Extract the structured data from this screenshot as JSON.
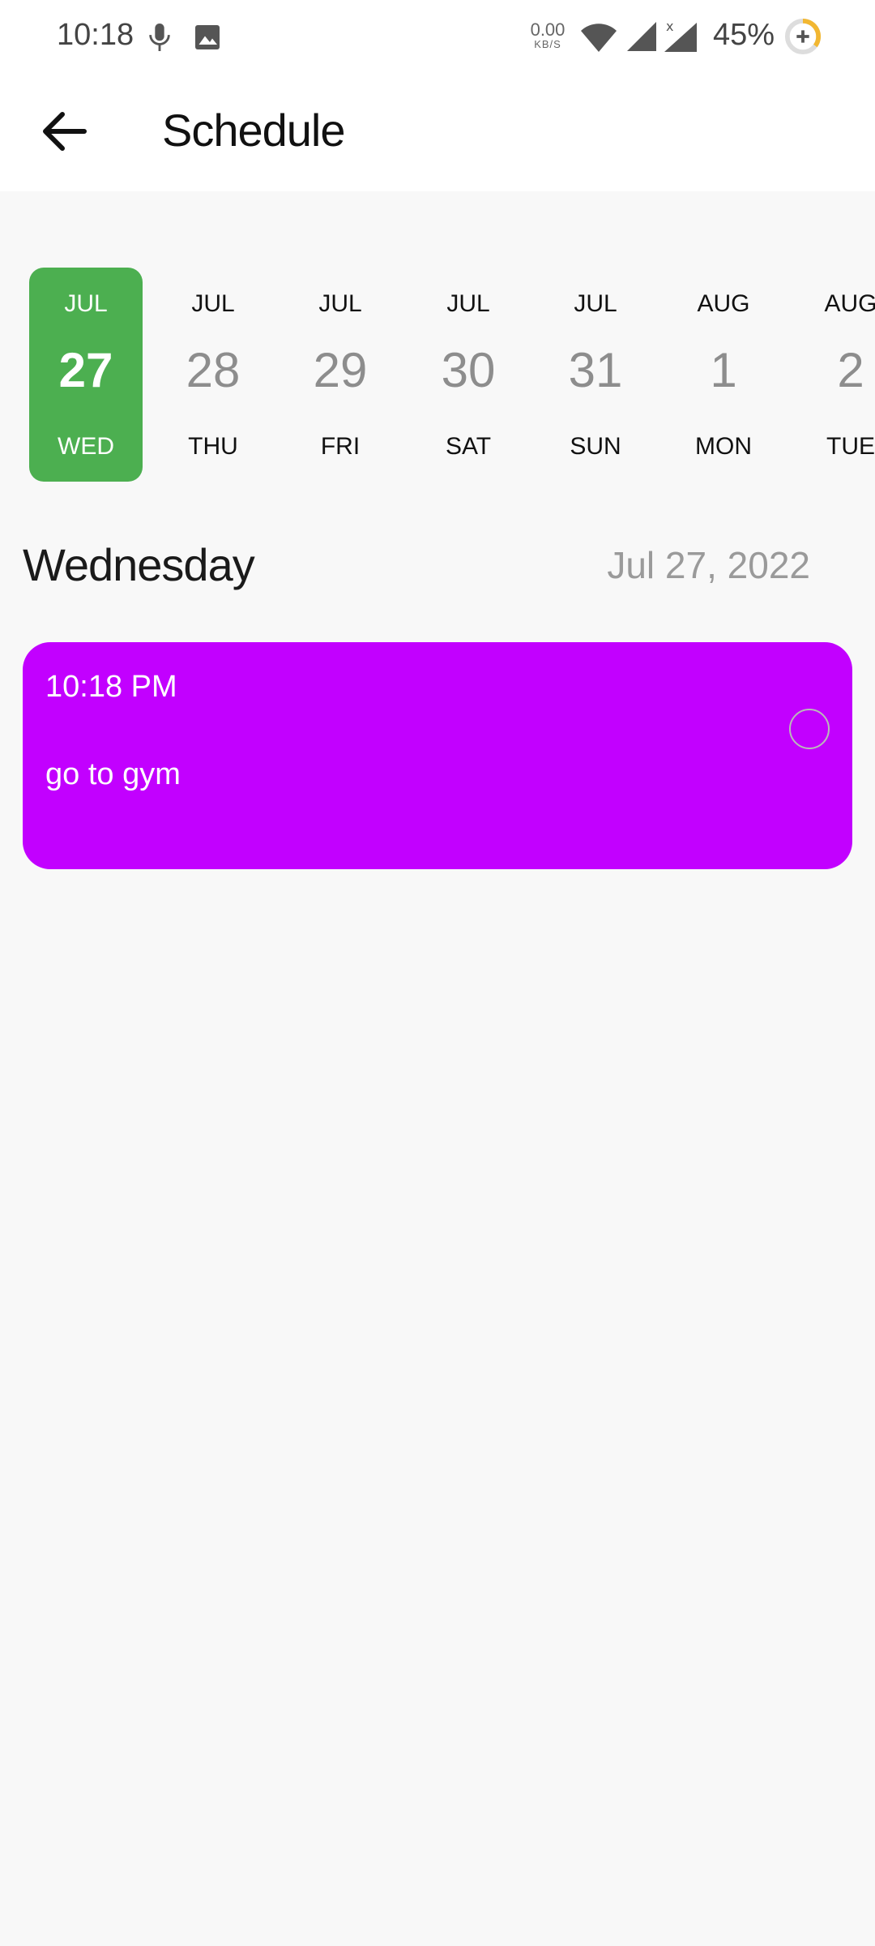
{
  "status_bar": {
    "time": "10:18",
    "net_speed_value": "0.00",
    "net_speed_unit": "KB/S",
    "battery": "45%",
    "icons": [
      "mic-icon",
      "image-icon",
      "wifi-icon",
      "signal-icon",
      "signal-x-icon",
      "battery-icon"
    ]
  },
  "app_bar": {
    "title": "Schedule",
    "back_icon": "arrow-left-icon"
  },
  "date_strip": {
    "selected_index": 0,
    "items": [
      {
        "month": "JUL",
        "day": "27",
        "dow": "WED"
      },
      {
        "month": "JUL",
        "day": "28",
        "dow": "THU"
      },
      {
        "month": "JUL",
        "day": "29",
        "dow": "FRI"
      },
      {
        "month": "JUL",
        "day": "30",
        "dow": "SAT"
      },
      {
        "month": "JUL",
        "day": "31",
        "dow": "SUN"
      },
      {
        "month": "AUG",
        "day": "1",
        "dow": "MON"
      },
      {
        "month": "AUG",
        "day": "2",
        "dow": "TUE"
      }
    ]
  },
  "day_header": {
    "day_name": "Wednesday",
    "date": "Jul 27, 2022"
  },
  "events": [
    {
      "time": "10:18 PM",
      "title": "go to gym",
      "done": false
    }
  ],
  "colors": {
    "selected_date": "#4caf50",
    "event_card": "#c200ff",
    "background": "#f8f8f8"
  }
}
